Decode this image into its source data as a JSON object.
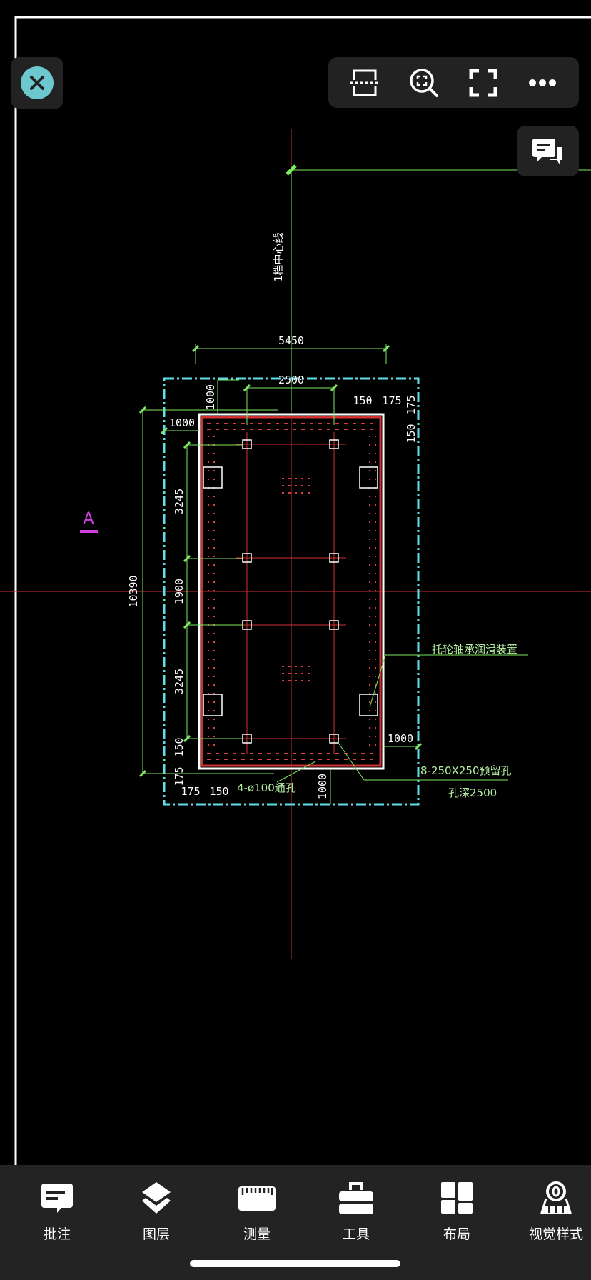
{
  "colors": {
    "background": "#000000",
    "toolbar": "#222222",
    "close_accent": "#6cc7cf",
    "axis_red": "#d03030",
    "dimension_green": "#7ee860",
    "boundary_cyan": "#5fe0e8",
    "annotation_magenta": "#d040e0"
  },
  "top_toolbar": {
    "buttons": [
      {
        "icon": "split-view-icon"
      },
      {
        "icon": "zoom-extent-icon"
      },
      {
        "icon": "fullscreen-icon"
      },
      {
        "icon": "more-icon"
      }
    ]
  },
  "drawing": {
    "centerline_label": "1档中心线",
    "marker": "A",
    "dimensions": {
      "overall_width": "5450",
      "inner_width": "2500",
      "top_offset": "1000",
      "top_right_a": "150",
      "top_right_b": "175",
      "right_top_a": "175",
      "right_top_b": "150",
      "left_offset": "1000",
      "span_top": "3245",
      "span_mid": "1900",
      "span_bottom": "3245",
      "overall_height": "10390",
      "left_bottom_a": "150",
      "left_bottom_b": "175",
      "bottom_left_a": "175",
      "bottom_left_b": "150",
      "bottom_offset": "1000",
      "right_offset": "1000"
    },
    "notes": {
      "lubrication": "托轮轴承润滑装置",
      "holes": "8-250X250预留孔",
      "hole_depth": "孔深2500",
      "through_holes": "4-ø100通孔"
    }
  },
  "bottom_nav": [
    {
      "label": "批注",
      "icon": "annotation-icon"
    },
    {
      "label": "图层",
      "icon": "layers-icon"
    },
    {
      "label": "测量",
      "icon": "ruler-icon"
    },
    {
      "label": "工具",
      "icon": "toolbox-icon"
    },
    {
      "label": "布局",
      "icon": "layout-icon"
    },
    {
      "label": "视觉样式",
      "icon": "visual-style-icon"
    }
  ]
}
